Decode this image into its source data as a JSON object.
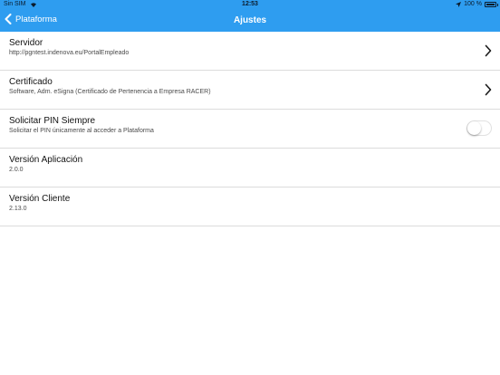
{
  "status_bar": {
    "carrier": "Sin SIM",
    "time": "12:53",
    "battery": "100 %"
  },
  "navbar": {
    "back_label": "Plataforma",
    "title": "Ajustes"
  },
  "settings": [
    {
      "title": "Servidor",
      "subtitle": "http://pgntest.indenova.eu/PortalEmpleado",
      "accessory": "chevron"
    },
    {
      "title": "Certificado",
      "subtitle": "Software, Adm. eSigna (Certificado de Pertenencia a Empresa RACER)",
      "accessory": "chevron"
    },
    {
      "title": "Solicitar PIN Siempre",
      "subtitle": "Solicitar el PIN únicamente al acceder a Plataforma",
      "accessory": "toggle",
      "toggle_on": false
    },
    {
      "title": "Versión Aplicación",
      "subtitle": "2.0.0",
      "accessory": "none"
    },
    {
      "title": "Versión Cliente",
      "subtitle": "2.13.0",
      "accessory": "none"
    }
  ],
  "colors": {
    "header": "#2e9df0",
    "separator": "#dcdcdc"
  }
}
